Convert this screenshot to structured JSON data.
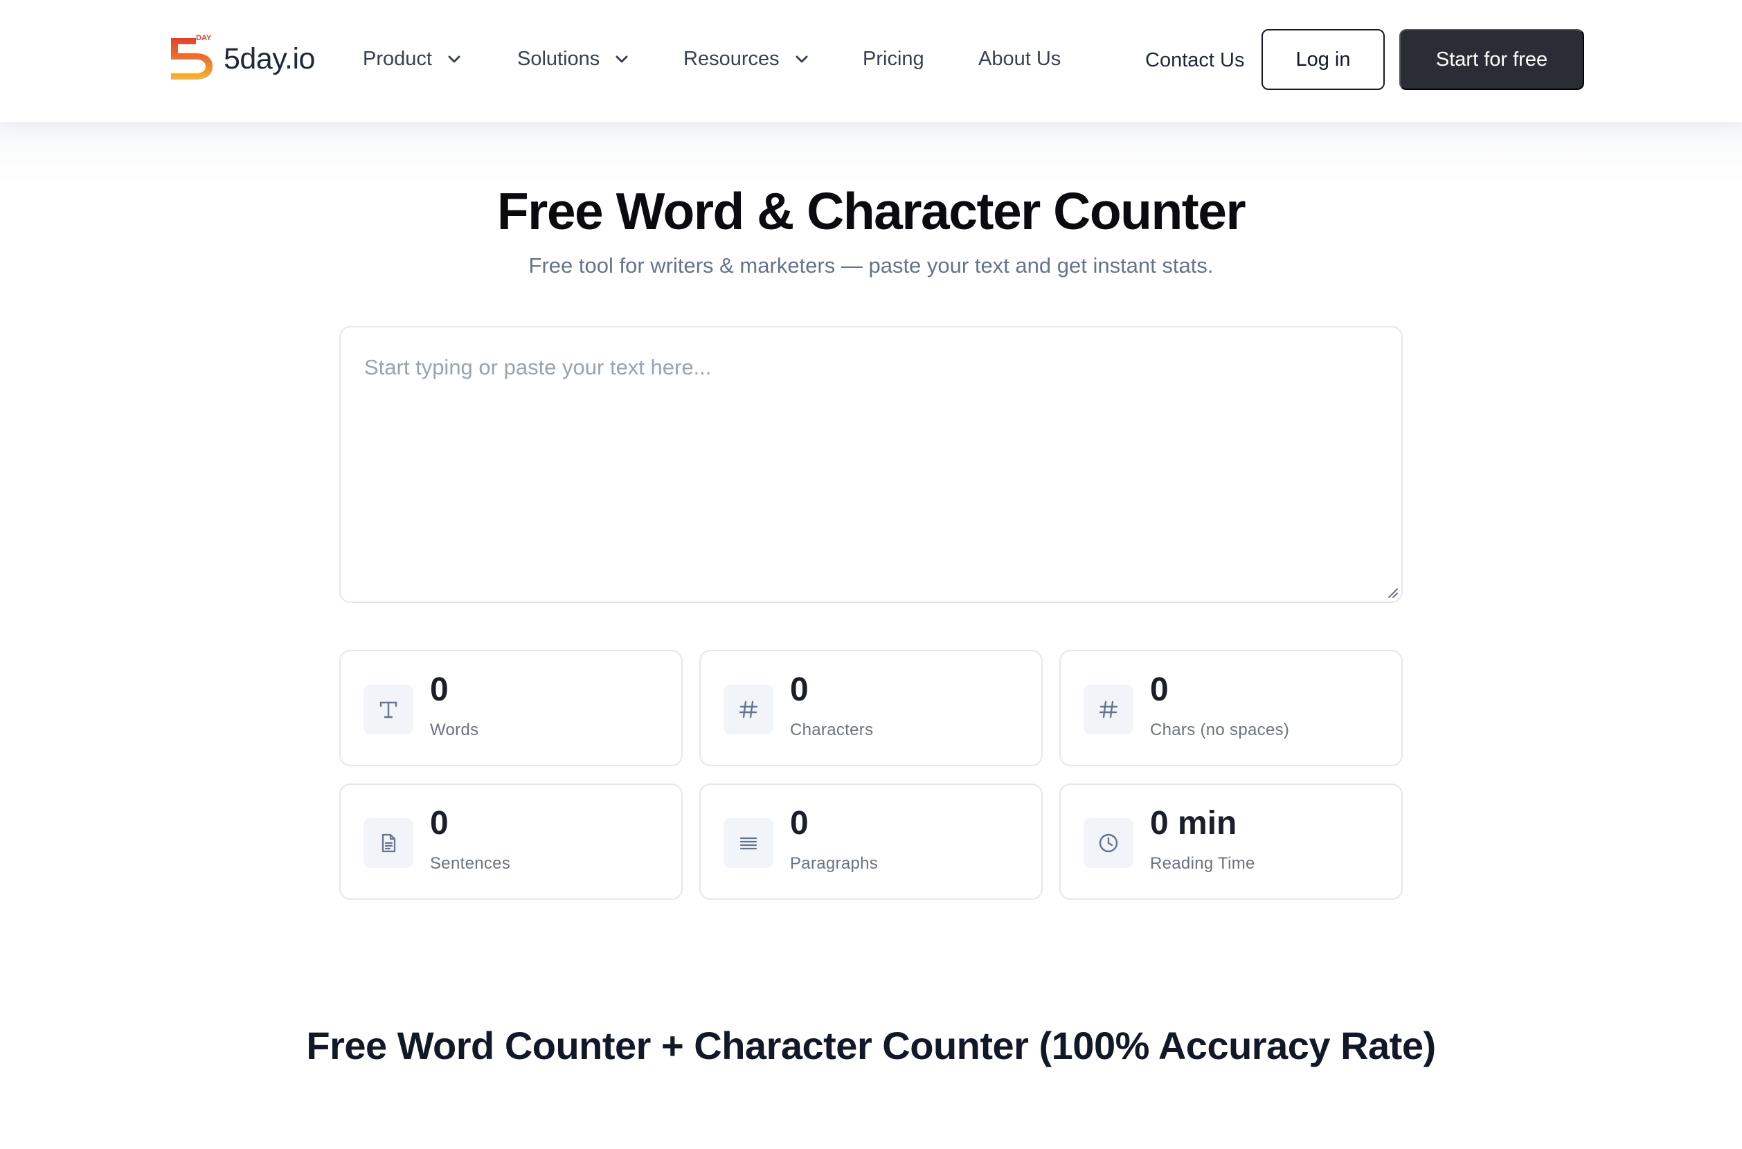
{
  "brand": {
    "name": "5day.io",
    "badge": "DAY"
  },
  "nav": {
    "items": [
      {
        "label": "Product",
        "has_dropdown": true
      },
      {
        "label": "Solutions",
        "has_dropdown": true
      },
      {
        "label": "Resources",
        "has_dropdown": true
      },
      {
        "label": "Pricing",
        "has_dropdown": false
      },
      {
        "label": "About Us",
        "has_dropdown": false
      }
    ],
    "contact_label": "Contact Us",
    "login_label": "Log in",
    "start_label": "Start for free"
  },
  "hero": {
    "title": "Free Word & Character Counter",
    "subtitle": "Free tool for writers & marketers — paste your text and get instant stats."
  },
  "editor": {
    "placeholder": "Start typing or paste your text here...",
    "value": ""
  },
  "stats": [
    {
      "icon": "text-t-icon",
      "value": "0",
      "label": "Words"
    },
    {
      "icon": "hash-icon",
      "value": "0",
      "label": "Characters"
    },
    {
      "icon": "hash-icon",
      "value": "0",
      "label": "Chars (no spaces)"
    },
    {
      "icon": "document-icon",
      "value": "0",
      "label": "Sentences"
    },
    {
      "icon": "paragraph-lines-icon",
      "value": "0",
      "label": "Paragraphs"
    },
    {
      "icon": "clock-icon",
      "value": "0 min",
      "label": "Reading Time"
    }
  ],
  "section_heading": "Free Word Counter + Character Counter (100% Accuracy Rate)",
  "colors": {
    "primary_button": "#2a2d35",
    "logo_red": "#e2402f",
    "logo_yellow": "#f6b731",
    "muted_text": "#64748b"
  }
}
